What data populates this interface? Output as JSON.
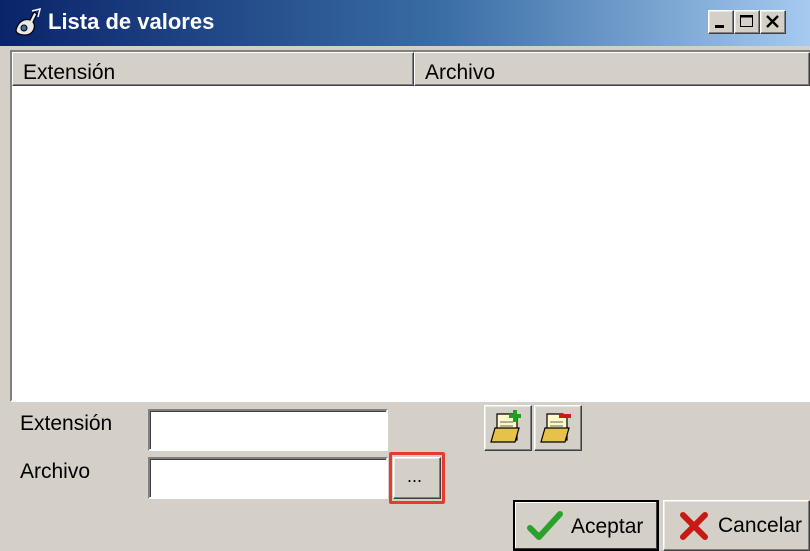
{
  "window": {
    "title": "Lista de valores"
  },
  "list": {
    "columns": [
      "Extensión",
      "Archivo"
    ],
    "rows": []
  },
  "form": {
    "extension_label": "Extensión",
    "extension_value": "",
    "archivo_label": "Archivo",
    "archivo_value": "",
    "browse_label": "..."
  },
  "actions": {
    "accept_label": "Aceptar",
    "cancel_label": "Cancelar"
  },
  "colors": {
    "title_active": "#0a246a",
    "title_fade": "#a6caf0",
    "face": "#d4d0c8",
    "highlight_box": "#e53b2e",
    "accept_check": "#2aa12a",
    "cancel_x": "#c81a14"
  }
}
